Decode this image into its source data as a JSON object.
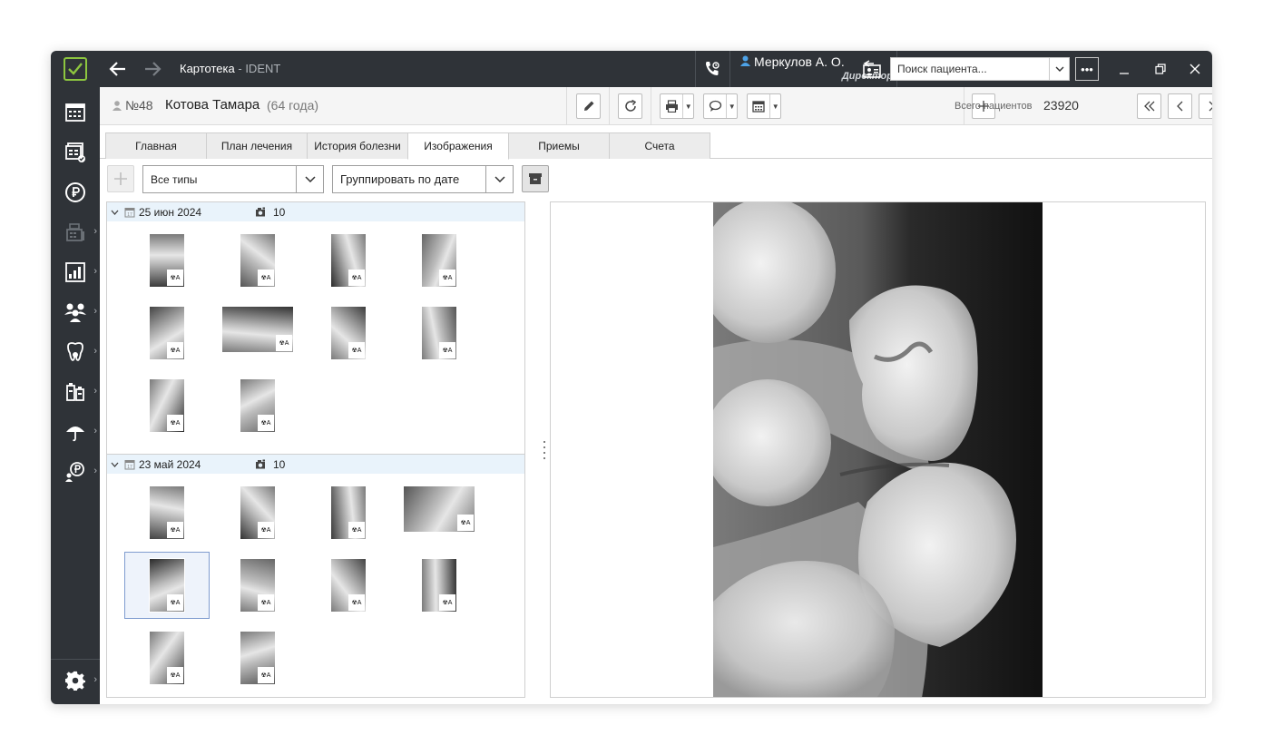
{
  "titlebar": {
    "title": "Картотека",
    "title_sep": " - ",
    "app": "IDENT",
    "user_name": "Меркулов А. О.",
    "user_role": "Директор",
    "search_placeholder": "Поиск пациента...",
    "more_label": "•••"
  },
  "patient": {
    "number": "№48",
    "name": "Котова Тамара",
    "age": "(64 года)",
    "total_label": "Всего пациентов",
    "total_value": "23920"
  },
  "tabs": [
    {
      "label": "Главная"
    },
    {
      "label": "План лечения"
    },
    {
      "label": "История болезни"
    },
    {
      "label": "Изображения"
    },
    {
      "label": "Приемы"
    },
    {
      "label": "Счета"
    }
  ],
  "active_tab": "Изображения",
  "filter": {
    "type_value": "Все типы",
    "group_value": "Группировать по дате"
  },
  "groups": [
    {
      "date": "25 июн 2024",
      "count": "10"
    },
    {
      "date": "23 май 2024",
      "count": "10"
    }
  ],
  "colors": {
    "dark": "#2f3338",
    "accent": "#8dc63f",
    "group_header": "#e9f3fb",
    "selection": "#7f9ccf"
  },
  "icons": {
    "logo": "checkbox-logo-icon",
    "back": "arrow-left-icon",
    "forward": "arrow-right-icon",
    "phone": "phone-icon",
    "user": "user-icon",
    "badge": "radiation-icon"
  }
}
